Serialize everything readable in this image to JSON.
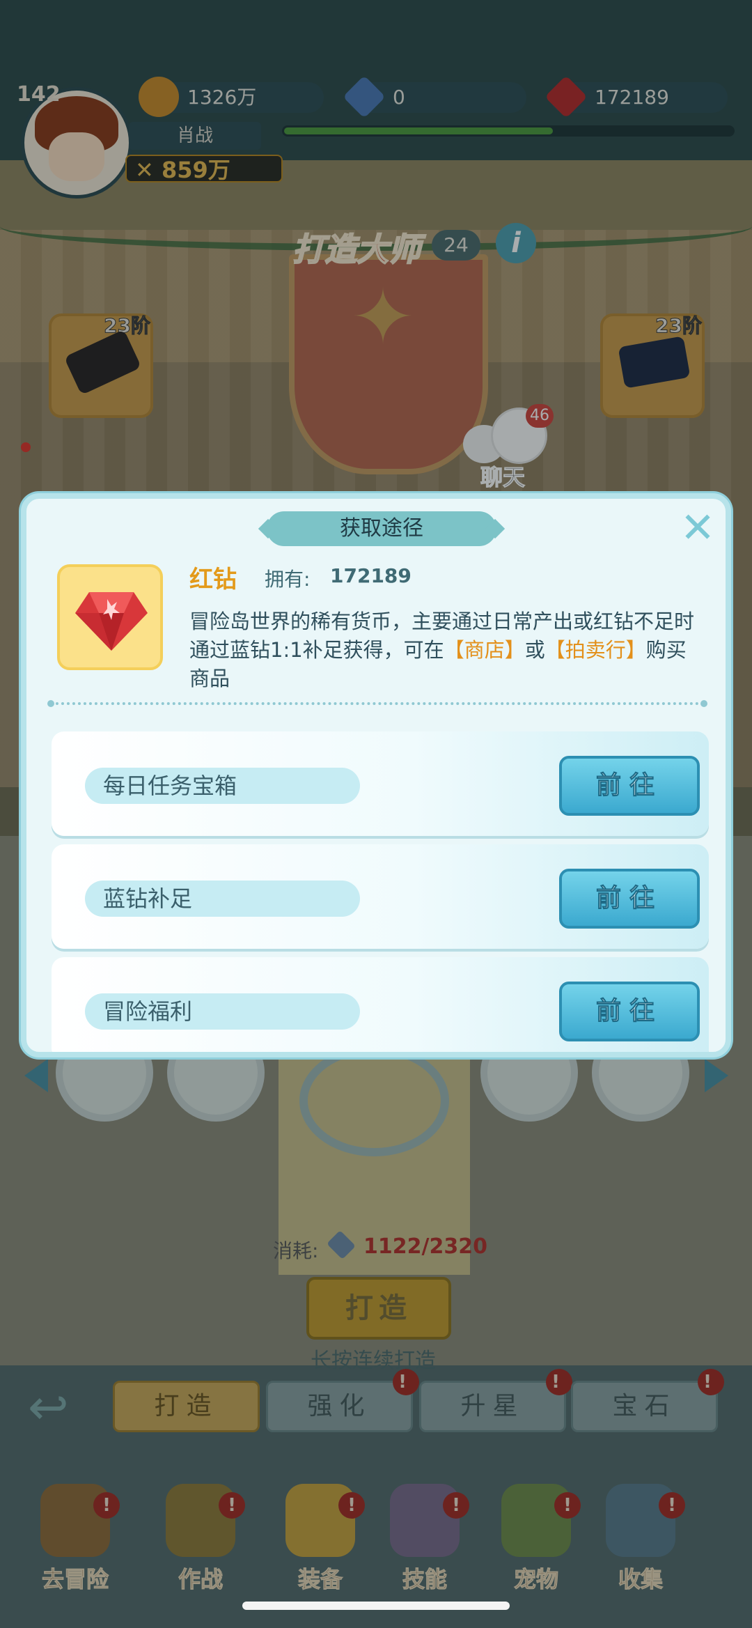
{
  "hud": {
    "level": "142",
    "player_name": "肖战",
    "gold": "1326万",
    "blue_diamond": "0",
    "red_diamond": "172189",
    "power": "859万",
    "xp_fraction": 0.6
  },
  "scene": {
    "title": "打造大师",
    "title_level": "24",
    "info_icon": "i",
    "left_slot_tier": "23阶",
    "right_slot_tier": "23阶",
    "chat_label": "聊天",
    "chat_count": "46",
    "cost_label": "消耗:",
    "cost_value": "1122/2320",
    "forge_button": "打造",
    "forge_hint": "长按连续打造",
    "back_icon": "back-arrow-icon"
  },
  "tabs": [
    {
      "label": "打造",
      "alert": ""
    },
    {
      "label": "强化",
      "alert": "!"
    },
    {
      "label": "升星",
      "alert": "!"
    },
    {
      "label": "宝石",
      "alert": "!"
    }
  ],
  "nav": [
    {
      "label": "去冒险",
      "alert": "!"
    },
    {
      "label": "作战",
      "alert": "!"
    },
    {
      "label": "装备",
      "alert": "!"
    },
    {
      "label": "技能",
      "alert": "!"
    },
    {
      "label": "宠物",
      "alert": "!"
    },
    {
      "label": "收集",
      "alert": "!"
    }
  ],
  "modal": {
    "title": "获取途径",
    "close_icon": "close-icon",
    "item_name": "红钻",
    "owned_label": "拥有:",
    "owned_value": "172189",
    "desc_part1": "冒险岛世界的稀有货币，主要通过日常产出或红钻不足时通过蓝钻1:1补足获得，可在",
    "desc_shop": "【商店】",
    "desc_or": "或",
    "desc_auction": "【拍卖行】",
    "desc_part2": "购买商品",
    "routes": [
      {
        "label": "每日任务宝箱",
        "button": "前往"
      },
      {
        "label": "蓝钻补足",
        "button": "前往"
      },
      {
        "label": "冒险福利",
        "button": "前往"
      }
    ]
  },
  "colors": {
    "accent": "#3ba9cf",
    "highlight": "#e3901a",
    "gem_red": "#d8373a"
  }
}
